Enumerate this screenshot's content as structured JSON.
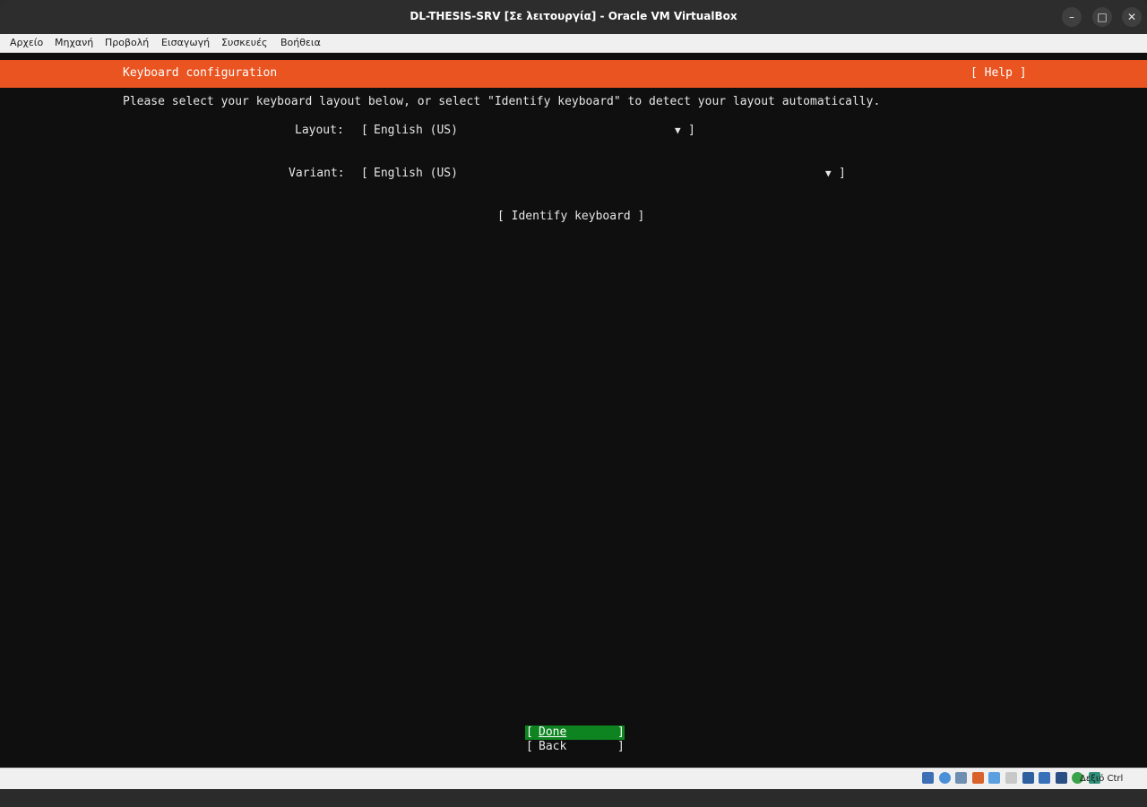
{
  "window": {
    "title": "DL-THESIS-SRV [Σε λειτουργία] - Oracle VM VirtualBox",
    "minimize_glyph": "–",
    "maximize_glyph": "□",
    "close_glyph": "✕"
  },
  "menu": {
    "items": [
      "Αρχείο",
      "Μηχανή",
      "Προβολή",
      "Εισαγωγή",
      "Συσκευές",
      "Βοήθεια"
    ]
  },
  "installer": {
    "header_title": "Keyboard configuration",
    "help_label": "[ Help ]",
    "description": "Please select your keyboard layout below, or select \"Identify keyboard\" to detect your layout automatically.",
    "layout": {
      "label": "Layout:",
      "open": "[",
      "value": "English (US)",
      "arrow": "▼",
      "close": "]"
    },
    "variant": {
      "label": "Variant:",
      "open": "[",
      "value": "English (US)",
      "arrow": "▼",
      "close": "]"
    },
    "identify_label": "[ Identify keyboard ]",
    "done": {
      "open": "[",
      "label": "Done",
      "close": "]"
    },
    "back": {
      "open": "[",
      "label": "Back",
      "close": "]"
    },
    "colors": {
      "accent": "#e95420",
      "selected": "#0e8420",
      "background": "#0f0f0f"
    }
  },
  "statusbar": {
    "icons": [
      "hard-disk-icon",
      "optical-drive-icon",
      "audio-icon",
      "network-icon",
      "usb-icon",
      "shared-folder-icon",
      "display-icon",
      "recording-icon",
      "cpu-icon",
      "mouse-integration-icon",
      "keyboard-capture-icon"
    ],
    "host_key": "Δεξιό Ctrl"
  }
}
